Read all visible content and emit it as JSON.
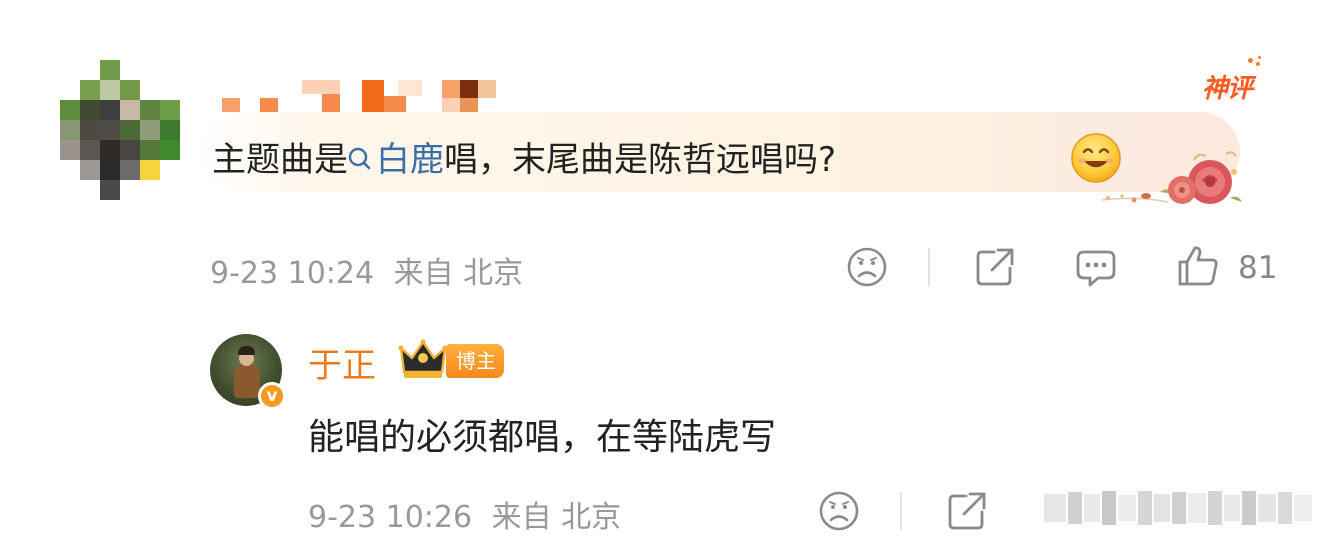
{
  "comment": {
    "badge_label": "神评",
    "text_before": "主题曲是",
    "topic_link": "白鹿",
    "text_after": "唱，末尾曲是陈哲远唱吗?",
    "time": "9-23 10:24",
    "source": "来自 北京",
    "like_count": "81",
    "icons": [
      "sad-face-icon",
      "share-icon",
      "comment-icon",
      "thumbs-up-icon",
      "smile-emoji-icon",
      "search-icon"
    ]
  },
  "reply": {
    "name": "于正",
    "author_tag": "博主",
    "verified_mark": "v",
    "text": "能唱的必须都唱，在等陆虎写",
    "time": "9-23 10:26",
    "source": "来自 北京"
  },
  "colors": {
    "accent_orange": "#f07b1a",
    "link_blue": "#3b6ea8",
    "meta_gray": "#999999",
    "badge_red": "#ff5a1f"
  }
}
